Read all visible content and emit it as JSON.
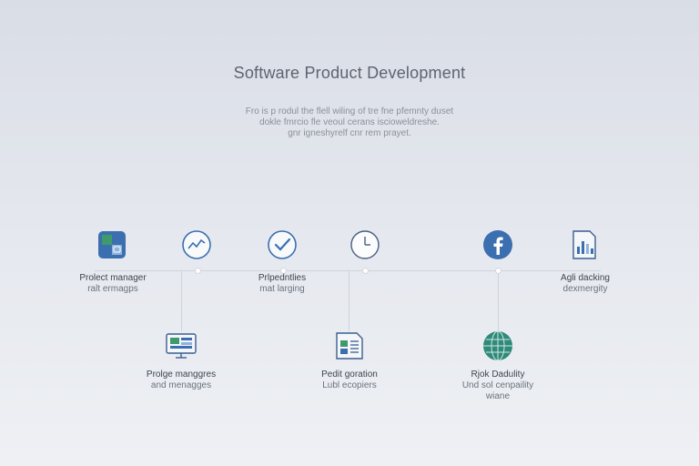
{
  "header": {
    "title": "Software Product Development",
    "subtitle_lines": [
      "Fro is p rodul the flell wiling of tre fne pfemnty duset",
      "dokle fmrcio fle veoul cerans iscioweldreshe.",
      "gnr igneshyrelf cnr rem prayet."
    ]
  },
  "top_nodes": [
    {
      "icon": "project-manager-icon",
      "title": "Prolect manager",
      "desc": "ralt ermagps"
    },
    {
      "icon": "trend-chart-icon",
      "title": "",
      "desc": ""
    },
    {
      "icon": "check-circle-icon",
      "title": "Prlpedntlies",
      "desc": "mat larging"
    },
    {
      "icon": "clock-icon",
      "title": "",
      "desc": ""
    },
    {
      "icon": "facebook-icon",
      "title": "",
      "desc": ""
    },
    {
      "icon": "agile-document-icon",
      "title": "Agli dacking",
      "desc": "dexmergity"
    }
  ],
  "bottom_nodes": [
    {
      "icon": "monitor-dashboard-icon",
      "title": "Prolge manggres",
      "desc": "and menagges"
    },
    {
      "icon": "document-list-icon",
      "title": "Pedit goration",
      "desc": "Lubl ecopiers"
    },
    {
      "icon": "globe-icon",
      "title": "Rjok Dadulity",
      "desc": "Und sol cenpaility",
      "desc2": "wiane"
    }
  ],
  "colors": {
    "accent": "#3b6fb0",
    "green": "#3f9a6b",
    "globe": "#2f8a7a",
    "line": "#cfd3db"
  }
}
